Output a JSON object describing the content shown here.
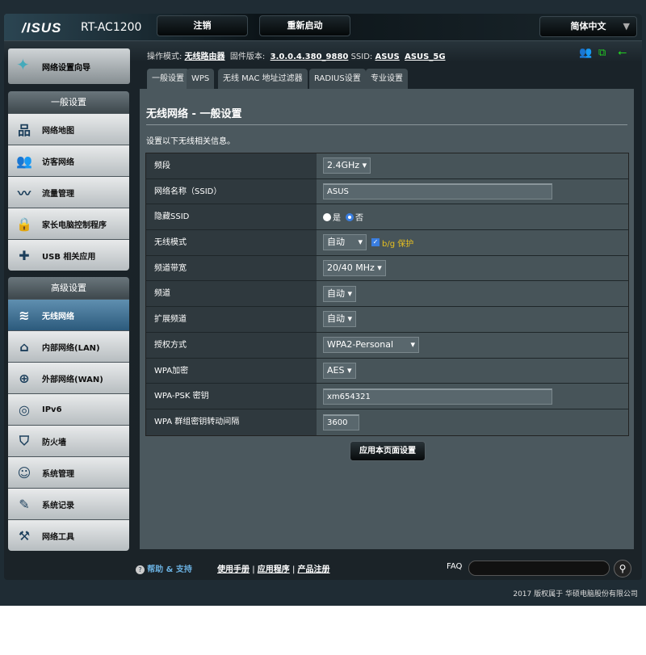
{
  "header": {
    "logo": "/ISUS",
    "model": "RT-AC1200",
    "logout": "注销",
    "reboot": "重新启动",
    "language": "简体中文"
  },
  "info": {
    "mode_label": "操作模式:",
    "mode": "无线路由器",
    "fw_label": "固件版本:",
    "fw": "3.0.0.4.380_9880",
    "ssid_label": "SSID:",
    "ssid1": "ASUS",
    "ssid2": "ASUS_5G"
  },
  "sidebar": {
    "wizard": "网络设置向导",
    "general_title": "一般设置",
    "general": [
      {
        "label": "网络地图",
        "icon": "network-map-icon"
      },
      {
        "label": "访客网络",
        "icon": "guest-network-icon"
      },
      {
        "label": "流量管理",
        "icon": "traffic-icon"
      },
      {
        "label": "家长电脑控制程序",
        "icon": "parental-icon"
      },
      {
        "label": "USB 相关应用",
        "icon": "usb-app-icon"
      }
    ],
    "advanced_title": "高级设置",
    "advanced": [
      {
        "label": "无线网络",
        "icon": "wireless-icon",
        "selected": true
      },
      {
        "label": "内部网络(LAN)",
        "icon": "lan-icon"
      },
      {
        "label": "外部网络(WAN)",
        "icon": "wan-icon"
      },
      {
        "label": "IPv6",
        "icon": "ipv6-icon"
      },
      {
        "label": "防火墙",
        "icon": "firewall-icon"
      },
      {
        "label": "系统管理",
        "icon": "admin-icon"
      },
      {
        "label": "系统记录",
        "icon": "log-icon"
      },
      {
        "label": "网络工具",
        "icon": "tools-icon"
      }
    ]
  },
  "tabs": [
    "一般设置",
    "WPS",
    "无线 MAC 地址过滤器",
    "RADIUS设置",
    "专业设置"
  ],
  "panel": {
    "title": "无线网络 - 一般设置",
    "desc": "设置以下无线相关信息。",
    "rows": {
      "band": {
        "label": "频段",
        "value": "2.4GHz"
      },
      "ssid": {
        "label": "网络名称（SSID）",
        "value": "ASUS"
      },
      "hide": {
        "label": "隐藏SSID",
        "yes": "是",
        "no": "否",
        "selected": "否"
      },
      "mode": {
        "label": "无线模式",
        "value": "自动",
        "bg": "b/g 保护",
        "bg_checked": true
      },
      "bw": {
        "label": "频道带宽",
        "value": "20/40 MHz"
      },
      "ch": {
        "label": "频道",
        "value": "自动"
      },
      "ext": {
        "label": "扩展频道",
        "value": "自动"
      },
      "auth": {
        "label": "授权方式",
        "value": "WPA2-Personal"
      },
      "enc": {
        "label": "WPA加密",
        "value": "AES"
      },
      "psk": {
        "label": "WPA-PSK 密钥",
        "value": "xm654321"
      },
      "rekey": {
        "label": "WPA 群组密钥转动间隔",
        "value": "3600"
      }
    },
    "apply": "应用本页面设置"
  },
  "footer": {
    "help": "帮助 & 支持",
    "manual": "使用手册",
    "app": "应用程序",
    "register": "产品注册",
    "faq": "FAQ",
    "copyright": "2017 版权属于 华硕电脑股份有限公司"
  }
}
